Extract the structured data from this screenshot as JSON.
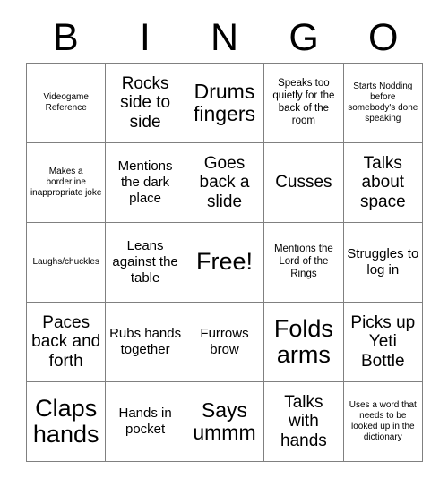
{
  "card": {
    "title": "BINGO",
    "header_letters": [
      "B",
      "I",
      "N",
      "G",
      "O"
    ],
    "grid_size": "5x5",
    "free_space_label": "Free!",
    "free_space_position": "center",
    "colors": {
      "background": "#ffffff",
      "text": "#000000",
      "gridline": "#808080"
    },
    "rows": [
      [
        {
          "text": "Videogame Reference",
          "size": "xs"
        },
        {
          "text": "Rocks side to side",
          "size": "l"
        },
        {
          "text": "Drums fingers",
          "size": "xl"
        },
        {
          "text": "Speaks too quietly for the back of the room",
          "size": "s"
        },
        {
          "text": "Starts Nodding before somebody's done speaking",
          "size": "xs"
        }
      ],
      [
        {
          "text": "Makes a borderline inappropriate joke",
          "size": "xs"
        },
        {
          "text": "Mentions the dark place",
          "size": "m"
        },
        {
          "text": "Goes back a slide",
          "size": "l"
        },
        {
          "text": "Cusses",
          "size": "l"
        },
        {
          "text": "Talks about space",
          "size": "l"
        }
      ],
      [
        {
          "text": "Laughs/chuckles",
          "size": "xs"
        },
        {
          "text": "Leans against the table",
          "size": "m"
        },
        {
          "text": "Free!",
          "size": "xxl"
        },
        {
          "text": "Mentions the Lord of the Rings",
          "size": "s"
        },
        {
          "text": "Struggles to log in",
          "size": "m"
        }
      ],
      [
        {
          "text": "Paces back and forth",
          "size": "l"
        },
        {
          "text": "Rubs hands together",
          "size": "m"
        },
        {
          "text": "Furrows brow",
          "size": "m"
        },
        {
          "text": "Folds arms",
          "size": "xxl"
        },
        {
          "text": "Picks up Yeti Bottle",
          "size": "l"
        }
      ],
      [
        {
          "text": "Claps hands",
          "size": "xxl"
        },
        {
          "text": "Hands in pocket",
          "size": "m"
        },
        {
          "text": "Says ummm",
          "size": "xl"
        },
        {
          "text": "Talks with hands",
          "size": "l"
        },
        {
          "text": "Uses a word that needs to be looked up in the dictionary",
          "size": "xs"
        }
      ]
    ]
  }
}
